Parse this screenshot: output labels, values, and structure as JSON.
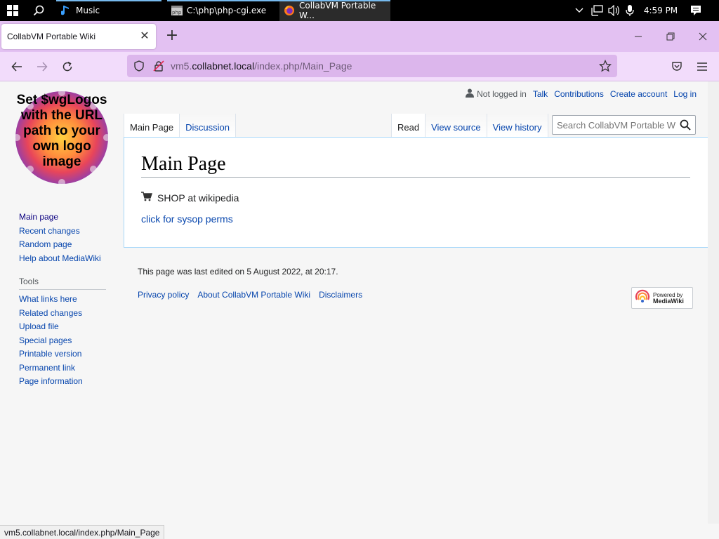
{
  "taskbar": {
    "apps": [
      {
        "label": "Music",
        "icon": "music-note-icon"
      },
      {
        "label": "C:\\php\\php-cgi.exe",
        "icon": "php-console-icon"
      },
      {
        "label": "CollabVM Portable W...",
        "icon": "firefox-icon"
      }
    ],
    "clock": "4:59 PM"
  },
  "browser": {
    "tab_title": "CollabVM Portable Wiki",
    "url_prefix": "vm5.",
    "url_host": "collabnet.local",
    "url_path": "/index.php/Main_Page",
    "status_url": "vm5.collabnet.local/index.php/Main_Page",
    "accent": "#e3c1f2"
  },
  "wiki": {
    "logo_text": "Set $wgLogos with the URL path to your own logo image",
    "personal": {
      "not_logged_in": "Not logged in",
      "talk": "Talk",
      "contributions": "Contributions",
      "create_account": "Create account",
      "log_in": "Log in"
    },
    "tabs_left": [
      "Main Page",
      "Discussion"
    ],
    "tabs_right": [
      "Read",
      "View source",
      "View history"
    ],
    "search_placeholder": "Search CollabVM Portable Wiki",
    "title": "Main Page",
    "shop": "SHOP at wikipedia",
    "sysop": "click for sysop perms",
    "nav": [
      "Main page",
      "Recent changes",
      "Random page",
      "Help about MediaWiki"
    ],
    "tools_heading": "Tools",
    "tools": [
      "What links here",
      "Related changes",
      "Upload file",
      "Special pages",
      "Printable version",
      "Permanent link",
      "Page information"
    ],
    "last_edited": "This page was last edited on 5 August 2022, at 20:17.",
    "footer": [
      "Privacy policy",
      "About CollabVM Portable Wiki",
      "Disclaimers"
    ],
    "powered_line1": "Powered by",
    "powered_line2": "MediaWiki"
  }
}
